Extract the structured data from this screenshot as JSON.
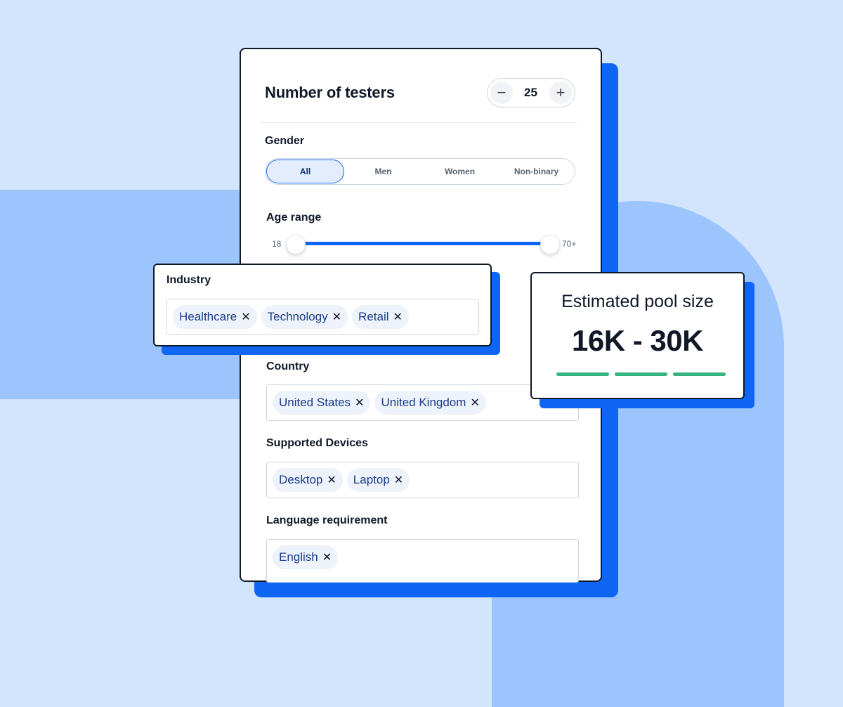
{
  "testers": {
    "title": "Number of testers",
    "decrement": "−",
    "value": "25",
    "increment": "+"
  },
  "gender": {
    "label": "Gender",
    "options": [
      "All",
      "Men",
      "Women",
      "Non-binary"
    ],
    "selected": "All"
  },
  "age": {
    "label": "Age range",
    "min": "18",
    "max": "70+",
    "selected_range": [
      "18",
      "70+"
    ]
  },
  "industry": {
    "label": "Industry",
    "chips": [
      "Healthcare",
      "Technology",
      "Retail"
    ]
  },
  "country": {
    "label": "Country",
    "chips": [
      "United States",
      "United Kingdom"
    ]
  },
  "devices": {
    "label": "Supported Devices",
    "chips": [
      "Desktop",
      "Laptop"
    ]
  },
  "language": {
    "label": "Language requirement",
    "chips": [
      "English"
    ]
  },
  "pool": {
    "title": "Estimated pool size",
    "value": "16K - 30K"
  },
  "chip_remove_glyph": "✕",
  "colors": {
    "accent": "#0f66f5",
    "background": "#d3e4fd",
    "background_shape": "#9cc4fd",
    "success": "#36b37e",
    "text": "#101828"
  }
}
